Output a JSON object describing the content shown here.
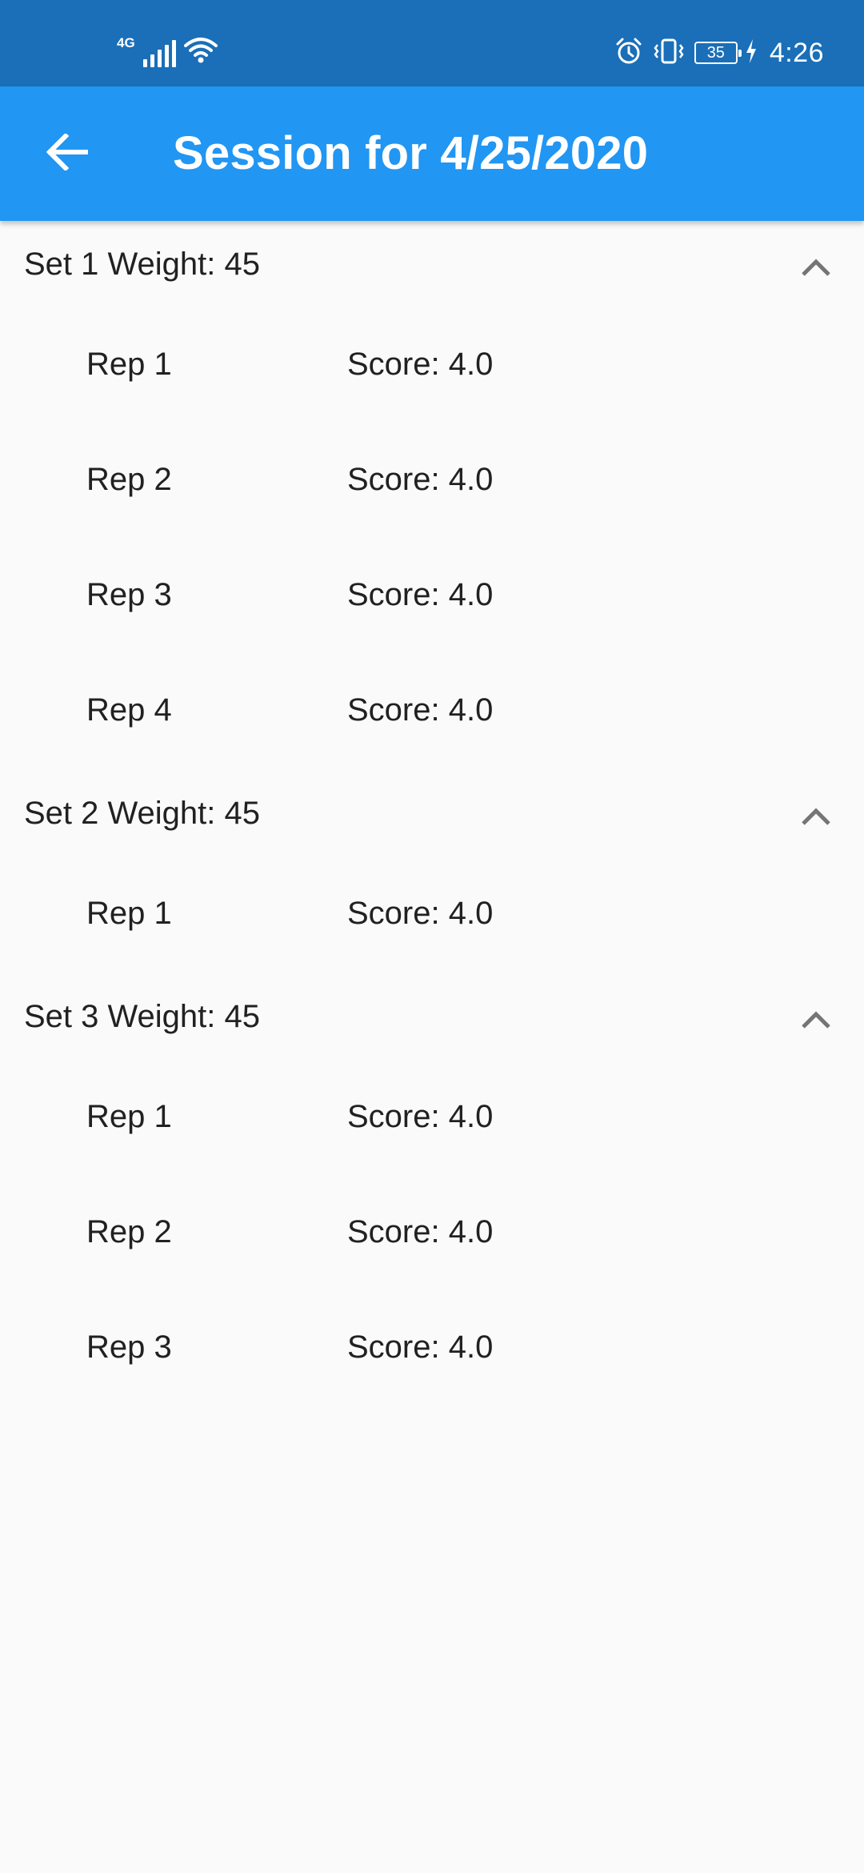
{
  "status_bar": {
    "network_type": "4G",
    "battery_level": "35",
    "time": "4:26"
  },
  "app_bar": {
    "title": "Session for 4/25/2020"
  },
  "sets": [
    {
      "title": "Set 1 Weight: 45",
      "reps": [
        {
          "label": "Rep 1",
          "score": "Score: 4.0"
        },
        {
          "label": "Rep 2",
          "score": "Score: 4.0"
        },
        {
          "label": "Rep 3",
          "score": "Score: 4.0"
        },
        {
          "label": "Rep 4",
          "score": "Score: 4.0"
        }
      ]
    },
    {
      "title": "Set 2 Weight: 45",
      "reps": [
        {
          "label": "Rep 1",
          "score": "Score: 4.0"
        }
      ]
    },
    {
      "title": "Set 3 Weight: 45",
      "reps": [
        {
          "label": "Rep 1",
          "score": "Score: 4.0"
        },
        {
          "label": "Rep 2",
          "score": "Score: 4.0"
        },
        {
          "label": "Rep 3",
          "score": "Score: 4.0"
        }
      ]
    }
  ],
  "colors": {
    "status_bar": "#1a6fb8",
    "app_bar": "#2196f3",
    "background": "#fafafa",
    "text": "#212121",
    "chevron": "#757575"
  }
}
